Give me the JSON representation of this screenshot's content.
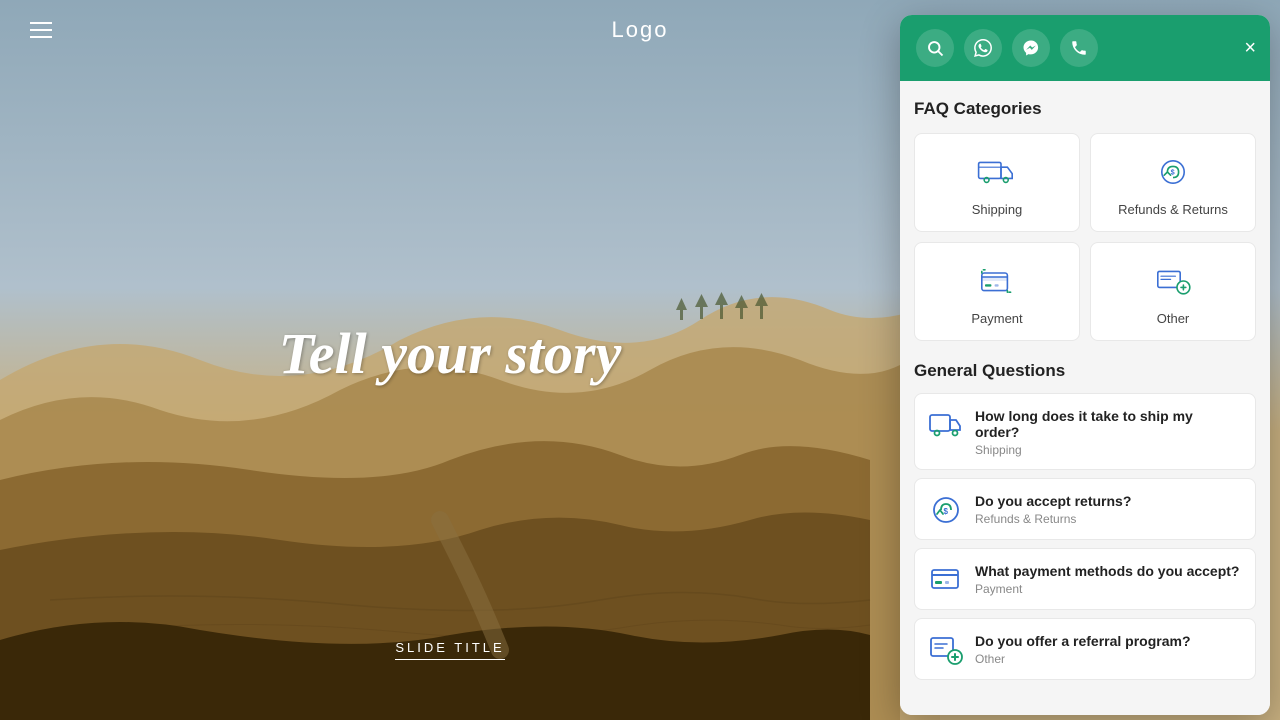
{
  "navbar": {
    "logo": "Logo"
  },
  "hero": {
    "title": "Tell your story",
    "slide_title": "SLIDE TITLE"
  },
  "panel": {
    "close_label": "×",
    "header_icons": [
      {
        "name": "search-icon",
        "symbol": "🔍"
      },
      {
        "name": "whatsapp-icon",
        "symbol": "💬"
      },
      {
        "name": "messenger-icon",
        "symbol": "✉"
      },
      {
        "name": "phone-icon",
        "symbol": "📞"
      }
    ],
    "faq_section_title": "FAQ Categories",
    "categories": [
      {
        "id": "shipping",
        "label": "Shipping"
      },
      {
        "id": "refunds",
        "label": "Refunds & Returns"
      },
      {
        "id": "payment",
        "label": "Payment"
      },
      {
        "id": "other",
        "label": "Other"
      }
    ],
    "general_section_title": "General Questions",
    "questions": [
      {
        "id": "q1",
        "title": "How long does it take to ship my order?",
        "subtitle": "Shipping"
      },
      {
        "id": "q2",
        "title": "Do you accept returns?",
        "subtitle": "Refunds & Returns"
      },
      {
        "id": "q3",
        "title": "What payment methods do you accept?",
        "subtitle": "Payment"
      },
      {
        "id": "q4",
        "title": "Do you offer a referral program?",
        "subtitle": "Other"
      }
    ]
  },
  "colors": {
    "accent": "#1a9e6e",
    "icon_blue": "#3b6fd4",
    "icon_teal": "#1a9e6e"
  }
}
